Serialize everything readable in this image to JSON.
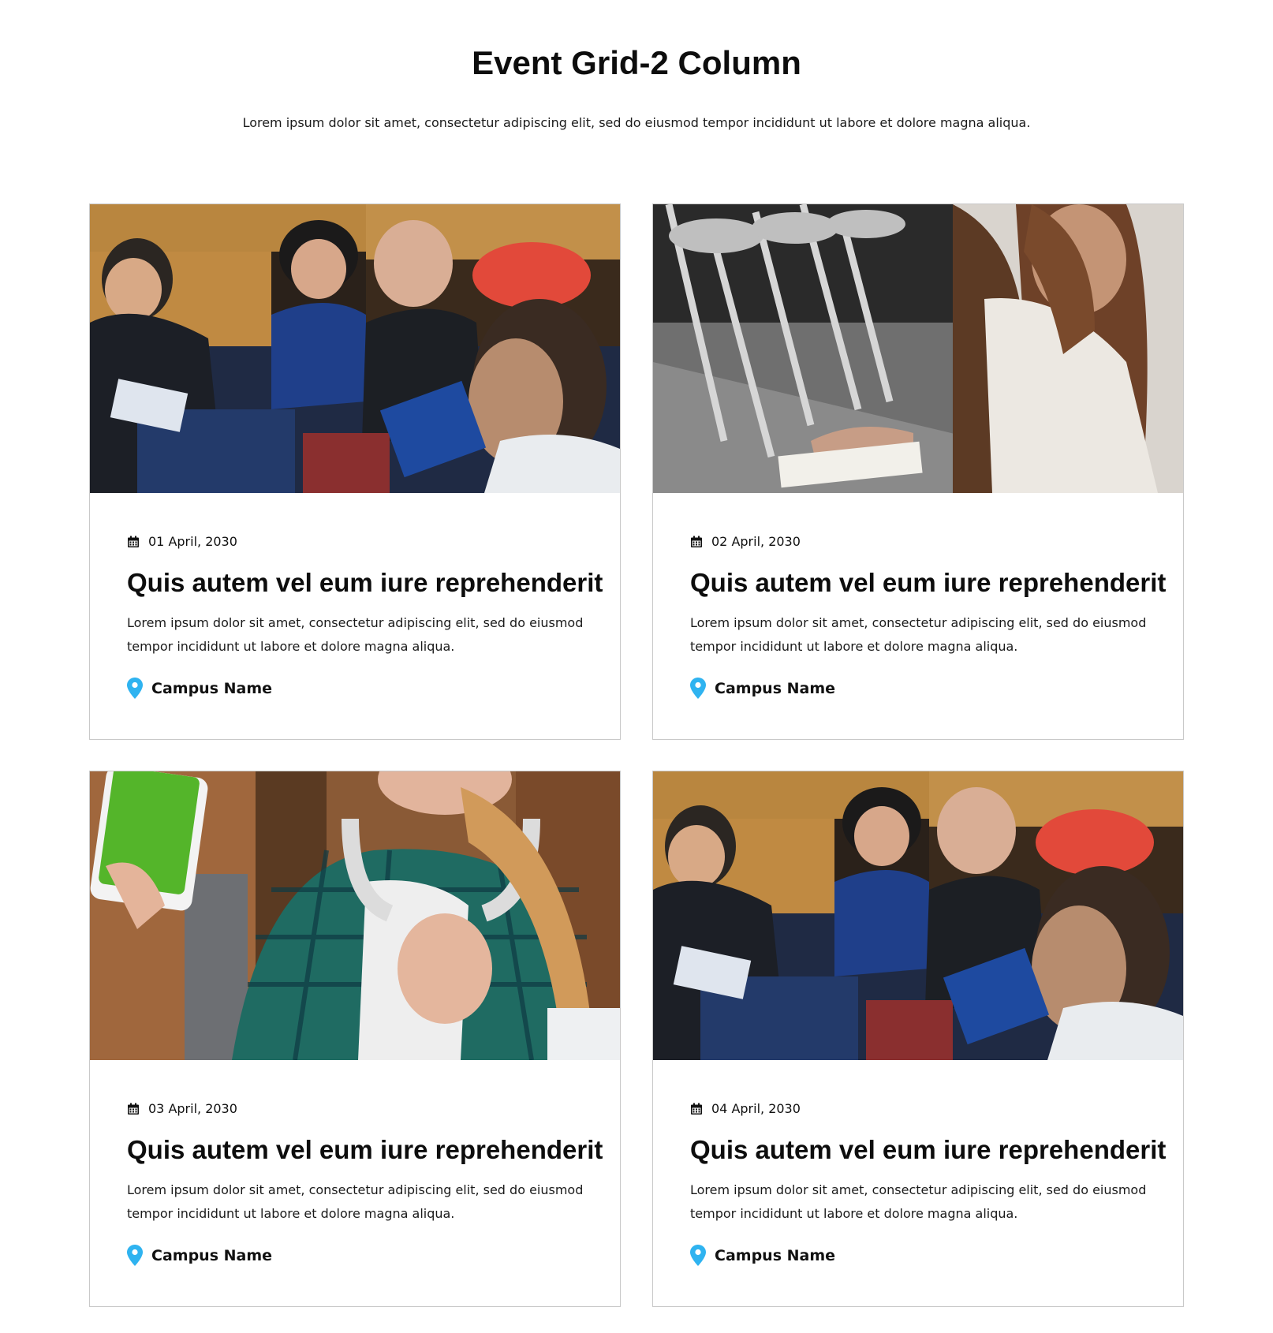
{
  "header": {
    "title": "Event Grid-2 Column",
    "subtitle": "Lorem ipsum dolor sit amet, consectetur adipiscing elit, sed do eiusmod tempor incididunt ut labore et dolore magna aliqua."
  },
  "colors": {
    "accent_pin": "#2fb3f0",
    "border": "#c9c9c9",
    "text": "#111111"
  },
  "icons": {
    "date": "calendar-icon",
    "location": "map-pin-icon"
  },
  "events": [
    {
      "date": "01 April, 2030",
      "title": "Quis autem vel eum iure reprehenderit",
      "description": "Lorem ipsum dolor sit amet, consectetur adipiscing elit, sed do eiusmod tempor incididunt ut labore et dolore magna aliqua.",
      "location": "Campus Name",
      "image": "photo of conference audience seated in auditorium"
    },
    {
      "date": "02 April, 2030",
      "title": "Quis autem vel eum iure reprehenderit",
      "description": "Lorem ipsum dolor sit amet, consectetur adipiscing elit, sed do eiusmod tempor incididunt ut labore et dolore magna aliqua.",
      "location": "Campus Name",
      "image": "photo of woman reading paper near folding chairs"
    },
    {
      "date": "03 April, 2030",
      "title": "Quis autem vel eum iure reprehenderit",
      "description": "Lorem ipsum dolor sit amet, consectetur adipiscing elit, sed do eiusmod tempor incididunt ut labore et dolore magna aliqua.",
      "location": "Campus Name",
      "image": "photo of student with headphones holding phone and thumbs up"
    },
    {
      "date": "04 April, 2030",
      "title": "Quis autem vel eum iure reprehenderit",
      "description": "Lorem ipsum dolor sit amet, consectetur adipiscing elit, sed do eiusmod tempor incididunt ut labore et dolore magna aliqua.",
      "location": "Campus Name",
      "image": "photo of conference audience seated in auditorium"
    }
  ]
}
